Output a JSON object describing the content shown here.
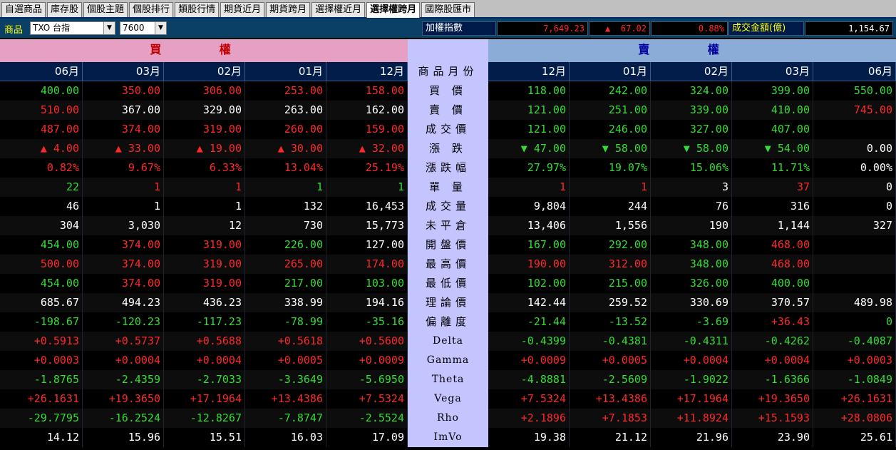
{
  "tabs": [
    "自選商品",
    "庫存股",
    "個股主題",
    "個股排行",
    "類股行情",
    "期貨近月",
    "期貨跨月",
    "選擇權近月",
    "選擇權跨月",
    "國際股匯市"
  ],
  "active_tab": 8,
  "toolbar": {
    "product_label": "商品",
    "product_value": "TXO 台指",
    "strike_value": "7600",
    "index_label": "加權指數",
    "index_value": "7,649.23",
    "index_change_arrow": "▲",
    "index_change": "67.02",
    "index_change_pct": "0.88%",
    "amount_label": "成交金額(億)",
    "amount_value": "1,154.67"
  },
  "header": {
    "call": "買 權",
    "put": "賣 權"
  },
  "row_labels": [
    "商品月份",
    "買 價",
    "賣 價",
    "成交價",
    "漲 跌",
    "漲跌幅",
    "單 量",
    "成交量",
    "未平倉",
    "開盤價",
    "最高價",
    "最低價",
    "理論價",
    "偏離度",
    "Delta",
    "Gamma",
    "Theta",
    "Vega",
    "Rho",
    "ImVo"
  ],
  "call_months": [
    "06月",
    "03月",
    "02月",
    "01月",
    "12月"
  ],
  "put_months": [
    "12月",
    "01月",
    "02月",
    "03月",
    "06月"
  ],
  "call_rows": [
    [
      [
        "400.00",
        "g"
      ],
      [
        "350.00",
        "r"
      ],
      [
        "306.00",
        "r"
      ],
      [
        "253.00",
        "r"
      ],
      [
        "158.00",
        "r"
      ]
    ],
    [
      [
        "510.00",
        "r"
      ],
      [
        "367.00",
        "w"
      ],
      [
        "329.00",
        "w"
      ],
      [
        "263.00",
        "w"
      ],
      [
        "162.00",
        "w"
      ]
    ],
    [
      [
        "487.00",
        "r"
      ],
      [
        "374.00",
        "r"
      ],
      [
        "319.00",
        "r"
      ],
      [
        "260.00",
        "r"
      ],
      [
        "159.00",
        "r"
      ]
    ],
    [
      [
        "▲ 4.00",
        "r"
      ],
      [
        "▲ 33.00",
        "r"
      ],
      [
        "▲ 19.00",
        "r"
      ],
      [
        "▲ 30.00",
        "r"
      ],
      [
        "▲ 32.00",
        "r"
      ]
    ],
    [
      [
        "0.82%",
        "r"
      ],
      [
        "9.67%",
        "r"
      ],
      [
        "6.33%",
        "r"
      ],
      [
        "13.04%",
        "r"
      ],
      [
        "25.19%",
        "r"
      ]
    ],
    [
      [
        "22",
        "g"
      ],
      [
        "1",
        "r"
      ],
      [
        "1",
        "r"
      ],
      [
        "1",
        "g"
      ],
      [
        "1",
        "g"
      ]
    ],
    [
      [
        "46",
        "w"
      ],
      [
        "1",
        "w"
      ],
      [
        "1",
        "w"
      ],
      [
        "132",
        "w"
      ],
      [
        "16,453",
        "w"
      ]
    ],
    [
      [
        "304",
        "w"
      ],
      [
        "3,030",
        "w"
      ],
      [
        "12",
        "w"
      ],
      [
        "730",
        "w"
      ],
      [
        "15,773",
        "w"
      ]
    ],
    [
      [
        "454.00",
        "g"
      ],
      [
        "374.00",
        "r"
      ],
      [
        "319.00",
        "r"
      ],
      [
        "226.00",
        "g"
      ],
      [
        "127.00",
        "w"
      ]
    ],
    [
      [
        "500.00",
        "r"
      ],
      [
        "374.00",
        "r"
      ],
      [
        "319.00",
        "r"
      ],
      [
        "265.00",
        "r"
      ],
      [
        "174.00",
        "r"
      ]
    ],
    [
      [
        "454.00",
        "g"
      ],
      [
        "374.00",
        "r"
      ],
      [
        "319.00",
        "r"
      ],
      [
        "217.00",
        "g"
      ],
      [
        "103.00",
        "g"
      ]
    ],
    [
      [
        "685.67",
        "w"
      ],
      [
        "494.23",
        "w"
      ],
      [
        "436.23",
        "w"
      ],
      [
        "338.99",
        "w"
      ],
      [
        "194.16",
        "w"
      ]
    ],
    [
      [
        "-198.67",
        "g"
      ],
      [
        "-120.23",
        "g"
      ],
      [
        "-117.23",
        "g"
      ],
      [
        "-78.99",
        "g"
      ],
      [
        "-35.16",
        "g"
      ]
    ],
    [
      [
        "+0.5913",
        "r"
      ],
      [
        "+0.5737",
        "r"
      ],
      [
        "+0.5688",
        "r"
      ],
      [
        "+0.5618",
        "r"
      ],
      [
        "+0.5600",
        "r"
      ]
    ],
    [
      [
        "+0.0003",
        "r"
      ],
      [
        "+0.0004",
        "r"
      ],
      [
        "+0.0004",
        "r"
      ],
      [
        "+0.0005",
        "r"
      ],
      [
        "+0.0009",
        "r"
      ]
    ],
    [
      [
        "-1.8765",
        "g"
      ],
      [
        "-2.4359",
        "g"
      ],
      [
        "-2.7033",
        "g"
      ],
      [
        "-3.3649",
        "g"
      ],
      [
        "-5.6950",
        "g"
      ]
    ],
    [
      [
        "+26.1631",
        "r"
      ],
      [
        "+19.3650",
        "r"
      ],
      [
        "+17.1964",
        "r"
      ],
      [
        "+13.4386",
        "r"
      ],
      [
        "+7.5324",
        "r"
      ]
    ],
    [
      [
        "-29.7795",
        "g"
      ],
      [
        "-16.2524",
        "g"
      ],
      [
        "-12.8267",
        "g"
      ],
      [
        "-7.8747",
        "g"
      ],
      [
        "-2.5524",
        "g"
      ]
    ],
    [
      [
        "14.12",
        "w"
      ],
      [
        "15.96",
        "w"
      ],
      [
        "15.51",
        "w"
      ],
      [
        "16.03",
        "w"
      ],
      [
        "17.09",
        "w"
      ]
    ]
  ],
  "put_rows": [
    [
      [
        "118.00",
        "g"
      ],
      [
        "242.00",
        "g"
      ],
      [
        "324.00",
        "g"
      ],
      [
        "399.00",
        "g"
      ],
      [
        "550.00",
        "g"
      ]
    ],
    [
      [
        "121.00",
        "g"
      ],
      [
        "251.00",
        "g"
      ],
      [
        "339.00",
        "g"
      ],
      [
        "410.00",
        "g"
      ],
      [
        "745.00",
        "r"
      ]
    ],
    [
      [
        "121.00",
        "g"
      ],
      [
        "246.00",
        "g"
      ],
      [
        "327.00",
        "g"
      ],
      [
        "407.00",
        "g"
      ],
      [
        "",
        ""
      ]
    ],
    [
      [
        "▼ 47.00",
        "g"
      ],
      [
        "▼ 58.00",
        "g"
      ],
      [
        "▼ 58.00",
        "g"
      ],
      [
        "▼ 54.00",
        "g"
      ],
      [
        "0.00",
        "w"
      ]
    ],
    [
      [
        "27.97%",
        "g"
      ],
      [
        "19.07%",
        "g"
      ],
      [
        "15.06%",
        "g"
      ],
      [
        "11.71%",
        "g"
      ],
      [
        "0.00%",
        "w"
      ]
    ],
    [
      [
        "1",
        "r"
      ],
      [
        "1",
        "r"
      ],
      [
        "3",
        "w"
      ],
      [
        "37",
        "r"
      ],
      [
        "0",
        "w"
      ]
    ],
    [
      [
        "9,804",
        "w"
      ],
      [
        "244",
        "w"
      ],
      [
        "76",
        "w"
      ],
      [
        "316",
        "w"
      ],
      [
        "0",
        "w"
      ]
    ],
    [
      [
        "13,406",
        "w"
      ],
      [
        "1,556",
        "w"
      ],
      [
        "190",
        "w"
      ],
      [
        "1,144",
        "w"
      ],
      [
        "327",
        "w"
      ]
    ],
    [
      [
        "167.00",
        "g"
      ],
      [
        "292.00",
        "g"
      ],
      [
        "348.00",
        "g"
      ],
      [
        "468.00",
        "r"
      ],
      [
        "",
        ""
      ]
    ],
    [
      [
        "190.00",
        "r"
      ],
      [
        "312.00",
        "r"
      ],
      [
        "348.00",
        "g"
      ],
      [
        "468.00",
        "r"
      ],
      [
        "",
        ""
      ]
    ],
    [
      [
        "102.00",
        "g"
      ],
      [
        "215.00",
        "g"
      ],
      [
        "326.00",
        "g"
      ],
      [
        "400.00",
        "g"
      ],
      [
        "",
        ""
      ]
    ],
    [
      [
        "142.44",
        "w"
      ],
      [
        "259.52",
        "w"
      ],
      [
        "330.69",
        "w"
      ],
      [
        "370.57",
        "w"
      ],
      [
        "489.98",
        "w"
      ]
    ],
    [
      [
        "-21.44",
        "g"
      ],
      [
        "-13.52",
        "g"
      ],
      [
        "-3.69",
        "g"
      ],
      [
        "+36.43",
        "r"
      ],
      [
        "0",
        "g"
      ]
    ],
    [
      [
        "-0.4399",
        "g"
      ],
      [
        "-0.4381",
        "g"
      ],
      [
        "-0.4311",
        "g"
      ],
      [
        "-0.4262",
        "g"
      ],
      [
        "-0.4087",
        "g"
      ]
    ],
    [
      [
        "+0.0009",
        "r"
      ],
      [
        "+0.0005",
        "r"
      ],
      [
        "+0.0004",
        "r"
      ],
      [
        "+0.0004",
        "r"
      ],
      [
        "+0.0003",
        "r"
      ]
    ],
    [
      [
        "-4.8881",
        "g"
      ],
      [
        "-2.5609",
        "g"
      ],
      [
        "-1.9022",
        "g"
      ],
      [
        "-1.6366",
        "g"
      ],
      [
        "-1.0849",
        "g"
      ]
    ],
    [
      [
        "+7.5324",
        "r"
      ],
      [
        "+13.4386",
        "r"
      ],
      [
        "+17.1964",
        "r"
      ],
      [
        "+19.3650",
        "r"
      ],
      [
        "+26.1631",
        "r"
      ]
    ],
    [
      [
        "+2.1896",
        "r"
      ],
      [
        "+7.1853",
        "r"
      ],
      [
        "+11.8924",
        "r"
      ],
      [
        "+15.1593",
        "r"
      ],
      [
        "+28.0806",
        "r"
      ]
    ],
    [
      [
        "19.38",
        "w"
      ],
      [
        "21.12",
        "w"
      ],
      [
        "21.96",
        "w"
      ],
      [
        "23.90",
        "w"
      ],
      [
        "25.61",
        "w"
      ]
    ]
  ]
}
